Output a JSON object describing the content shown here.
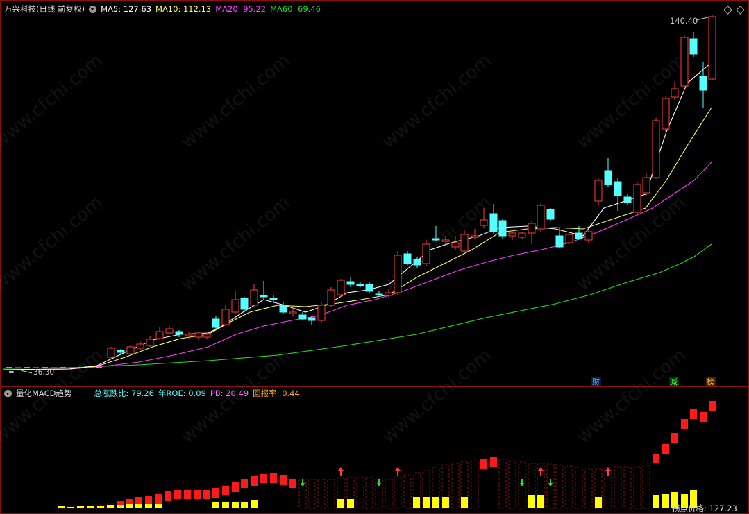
{
  "main_header": {
    "title": "万兴科技(日线 前复权)",
    "ma5": "MA5: 127.63",
    "ma10": "MA10: 112.13",
    "ma20": "MA20: 95.22",
    "ma60": "MA60: 69.46"
  },
  "price_labels": {
    "high": "140.40",
    "low": "36.30"
  },
  "event_markers": {
    "cai": "财",
    "jian": "减",
    "bang": "榜"
  },
  "sub_header": {
    "title": "量化MACD趋势",
    "zongzhangdiebi": "总涨跌比: 79.26",
    "roe": "年ROE: 0.09",
    "pb": "PB: 20.49",
    "huibaolv": "回报率: 0.44"
  },
  "bottom_label": "拐点价格: 127.23",
  "watermark": "www.cfchi.com",
  "colors": {
    "up": "#ff3b3b",
    "down": "#54ffff",
    "ma5": "#ffffff",
    "ma10": "#ffff55",
    "ma20": "#ff3cff",
    "ma60": "#22dd22",
    "bar_red": "#ff1a1a",
    "bar_yellow": "#ffff00"
  },
  "chart_data": {
    "type": "candlestick",
    "y_range_visible": [
      36.3,
      140.4
    ],
    "ma_values": {
      "MA5": 127.63,
      "MA10": 112.13,
      "MA20": 95.22,
      "MA60": 69.46
    }
  }
}
